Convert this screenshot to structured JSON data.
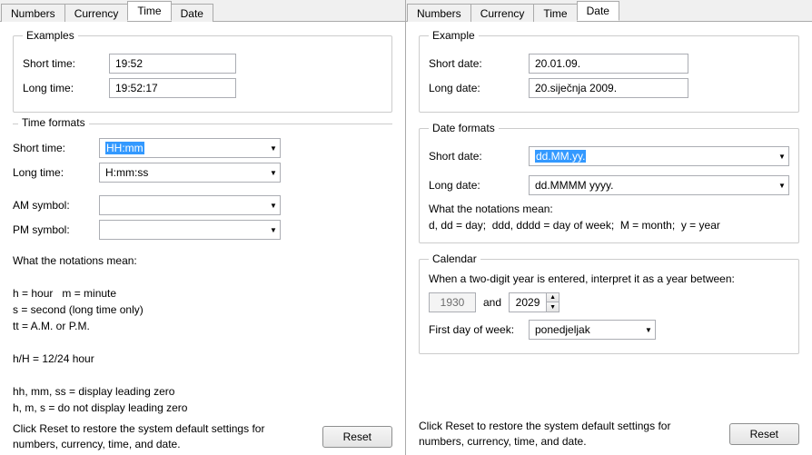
{
  "left": {
    "tabs": [
      "Numbers",
      "Currency",
      "Time",
      "Date"
    ],
    "active_tab_index": 2,
    "examples_legend": "Examples",
    "short_time_label": "Short time:",
    "long_time_label": "Long time:",
    "short_time_value": "19:52",
    "long_time_value": "19:52:17",
    "formats_legend": "Time formats",
    "fmt_short_label": "Short time:",
    "fmt_long_label": "Long time:",
    "fmt_am_label": "AM symbol:",
    "fmt_pm_label": "PM symbol:",
    "fmt_short_value": "HH:mm",
    "fmt_long_value": "H:mm:ss",
    "fmt_am_value": "",
    "fmt_pm_value": "",
    "notes_title": "What the notations mean:",
    "notes_line1": "h = hour   m = minute",
    "notes_line2": "s = second (long time only)",
    "notes_line3": "tt = A.M. or P.M.",
    "notes_line4": "h/H = 12/24 hour",
    "notes_line5": "hh, mm, ss = display leading zero",
    "notes_line6": "h, m, s = do not display leading zero",
    "footer_text": "Click Reset to restore the system default settings for numbers, currency, time, and date.",
    "reset_label": "Reset"
  },
  "right": {
    "tabs": [
      "Numbers",
      "Currency",
      "Time",
      "Date"
    ],
    "active_tab_index": 3,
    "example_legend": "Example",
    "short_date_label": "Short date:",
    "long_date_label": "Long date:",
    "short_date_value": "20.01.09.",
    "long_date_value": "20.siječnja 2009.",
    "formats_legend": "Date formats",
    "fmt_short_label": "Short date:",
    "fmt_long_label": "Long date:",
    "fmt_short_value": "dd.MM.yy.",
    "fmt_long_value": "dd.MMMM yyyy.",
    "notes_title": "What the notations mean:",
    "notes_line": "d, dd = day;  ddd, dddd = day of week;  M = month;  y = year",
    "calendar_legend": "Calendar",
    "cal_text": "When a two-digit year is entered, interpret it as a year between:",
    "cal_from": "1930",
    "cal_and": "and",
    "cal_to": "2029",
    "first_day_label": "First day of week:",
    "first_day_value": "ponedjeljak",
    "footer_text": "Click Reset to restore the system default settings for numbers, currency, time, and date.",
    "reset_label": "Reset"
  }
}
